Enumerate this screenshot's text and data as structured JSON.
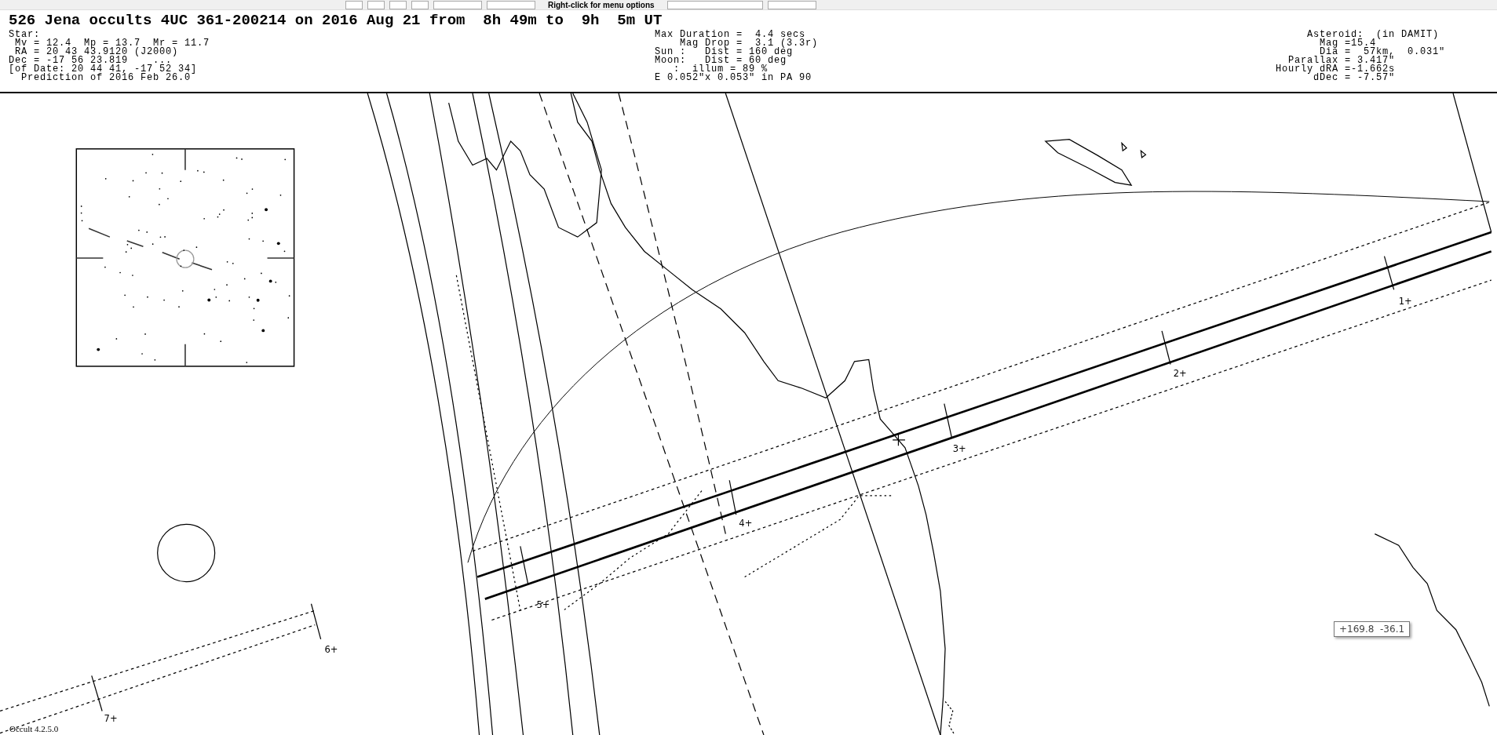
{
  "toolbar": {
    "hint": "Right-click for menu options"
  },
  "title": "526 Jena occults 4UC 361-200214 on 2016 Aug 21 from  8h 49m to  9h  5m UT",
  "star_info": [
    "Star:",
    " Mv = 12.4  Mp = 13.7  Mr = 11.7",
    " RA = 20 43 43.9120 (J2000)",
    "Dec = -17 56 23.819    ...",
    "[of Date: 20 44 41, -17 52 34]",
    "  Prediction of 2016 Feb 26.0"
  ],
  "event_info": [
    "Max Duration =  4.4 secs",
    "    Mag Drop =  3.1 (3.3r)",
    "Sun :   Dist = 160 deg",
    "Moon:   Dist = 60 deg",
    "   :  illum = 89 %",
    "E 0.052\"x 0.053\" in PA 90"
  ],
  "asteroid_info": [
    "     Asteroid:  (in DAMIT)",
    "       Mag =15.4",
    "       Dia =  57km,  0.031\"",
    "  Parallax = 3.417\"",
    "Hourly dRA =-1.662s",
    "      dDec = -7.57\""
  ],
  "path_marks": [
    "1+",
    "2+",
    "3+",
    "4+",
    "5+",
    "6+",
    "7+"
  ],
  "tooltip": "+169.8  -36.1",
  "version": "Occult 4.2.5.0"
}
